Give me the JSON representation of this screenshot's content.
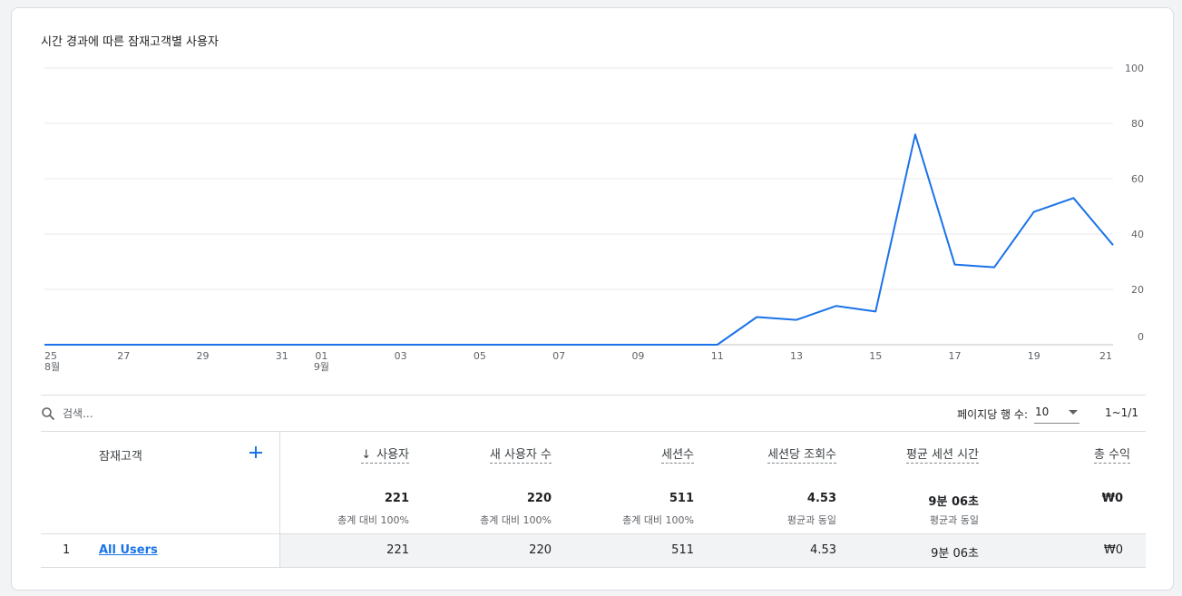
{
  "chart_title": "시간 경과에 따른 잠재고객별 사용자",
  "chart_data": {
    "type": "line",
    "title": "시간 경과에 따른 잠재고객별 사용자",
    "x_ticks": [
      "25",
      "27",
      "29",
      "31",
      "01",
      "03",
      "05",
      "07",
      "09",
      "11",
      "13",
      "15",
      "17",
      "19",
      "21"
    ],
    "x_month_labels": [
      {
        "at": "25",
        "label": "8월"
      },
      {
        "at": "01",
        "label": "9월"
      }
    ],
    "ylim": [
      0,
      100
    ],
    "y_ticks": [
      "0",
      "20",
      "40",
      "60",
      "80",
      "100"
    ],
    "grid": true,
    "axis_position": "right",
    "series": [
      {
        "color": "#1a73e8",
        "x": [
          "08-25",
          "08-26",
          "08-27",
          "08-28",
          "08-29",
          "08-30",
          "08-31",
          "09-01",
          "09-02",
          "09-03",
          "09-04",
          "09-05",
          "09-06",
          "09-07",
          "09-08",
          "09-09",
          "09-10",
          "09-11",
          "09-12",
          "09-13",
          "09-14",
          "09-15",
          "09-16",
          "09-17",
          "09-18",
          "09-19",
          "09-20",
          "09-21"
        ],
        "values": [
          0,
          0,
          0,
          0,
          0,
          0,
          0,
          0,
          0,
          0,
          0,
          0,
          0,
          0,
          0,
          0,
          0,
          0,
          10,
          9,
          14,
          12,
          76,
          29,
          28,
          48,
          53,
          36
        ]
      }
    ]
  },
  "search": {
    "placeholder": "검색..."
  },
  "pagination": {
    "rows_label": "페이지당 행 수:",
    "rows_value": "10",
    "range": "1~1/1"
  },
  "table": {
    "dimension_header": "잠재고객",
    "columns": [
      {
        "label": "사용자",
        "sorted": true,
        "total": "221",
        "total_sub": "총계 대비 100%"
      },
      {
        "label": "새 사용자 수",
        "total": "220",
        "total_sub": "총계 대비 100%"
      },
      {
        "label": "세션수",
        "total": "511",
        "total_sub": "총계 대비 100%"
      },
      {
        "label": "세션당 조회수",
        "total": "4.53",
        "total_sub": "평균과 동일"
      },
      {
        "label": "평균 세션 시간",
        "total": "9분 06초",
        "total_sub": "평균과 동일"
      },
      {
        "label": "총 수익",
        "total": "₩0",
        "total_sub": ""
      }
    ],
    "rows": [
      {
        "index": "1",
        "name": "All Users",
        "values": [
          "221",
          "220",
          "511",
          "4.53",
          "9분 06초",
          "₩0"
        ]
      }
    ]
  },
  "icons": {
    "search": "search-icon",
    "add": "add-icon",
    "dropdown": "caret-down-icon",
    "sort": "arrow-down-icon"
  },
  "colors": {
    "line": "#1a73e8",
    "link": "#1a73e8",
    "grid": "#e8eaed",
    "border": "#dadce0"
  }
}
